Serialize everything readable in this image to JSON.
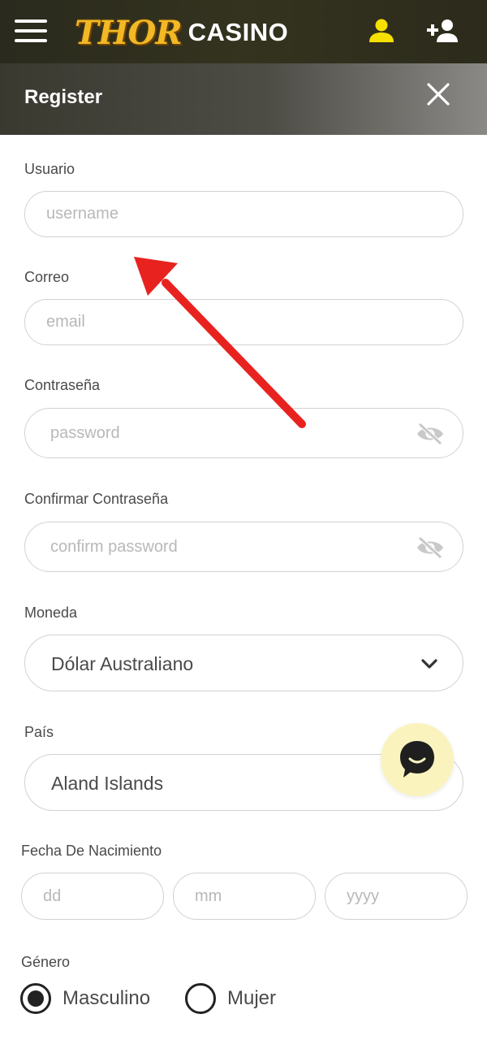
{
  "header": {
    "logo_thor": "THOR",
    "logo_casino": "CASINO",
    "icons": [
      "menu-icon",
      "user-icon",
      "add-user-icon"
    ]
  },
  "register": {
    "title": "Register",
    "close_icon": "close-icon"
  },
  "form": {
    "username": {
      "label": "Usuario",
      "placeholder": "username"
    },
    "email": {
      "label": "Correo",
      "placeholder": "email"
    },
    "password": {
      "label": "Contraseña",
      "placeholder": "password"
    },
    "confirm_password": {
      "label": "Confirmar Contraseña",
      "placeholder": "confirm password"
    },
    "currency": {
      "label": "Moneda",
      "value": "Dólar Australiano"
    },
    "country": {
      "label": "País",
      "value": "Aland Islands"
    },
    "birthdate": {
      "label": "Fecha De Nacimiento",
      "day_placeholder": "dd",
      "month_placeholder": "mm",
      "year_placeholder": "yyyy"
    },
    "gender": {
      "label": "Género",
      "options": [
        "Masculino",
        "Mujer"
      ],
      "selected": "Masculino"
    }
  },
  "colors": {
    "accent_yellow": "#f5e000",
    "logo_gold": "#f2b825",
    "arrow_red": "#e8231f",
    "chat_bg": "#faf3be"
  }
}
